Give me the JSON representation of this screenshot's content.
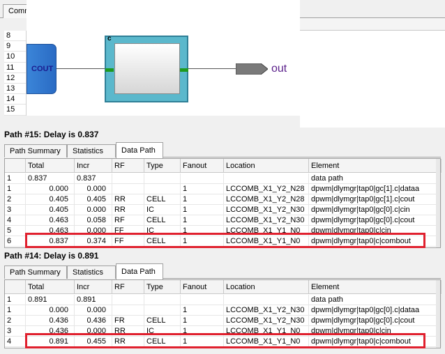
{
  "top": {
    "tab_label": "Comm",
    "row_numbers": [
      "8",
      "9",
      "10",
      "11",
      "12",
      "13",
      "14",
      "15"
    ],
    "schematic": {
      "cout_label": "COUT",
      "cell_label": "c",
      "out_label": "out",
      "colors": {
        "cout_block": "#2a6bc4",
        "cell_block": "#5bb8cc",
        "port": "#1e9a1e",
        "out_text": "#5a1f8a"
      }
    }
  },
  "columns": [
    "",
    "Total",
    "Incr",
    "RF",
    "Type",
    "Fanout",
    "Location",
    "Element"
  ],
  "sub_tabs": [
    "Path Summary",
    "Statistics",
    "Data Path"
  ],
  "active_tab": "Data Path",
  "highlight_color": "#e0202e",
  "paths": [
    {
      "title": "Path #15: Delay is 0.837",
      "rows": [
        [
          "1",
          "0.837",
          "0.837",
          "",
          "",
          "",
          "",
          "data path"
        ],
        [
          "1",
          "0.000",
          "0.000",
          "",
          "",
          "1",
          "LCCOMB_X1_Y2_N28",
          "dpwm|dlymgr|tap0|gc[1].c|dataa"
        ],
        [
          "2",
          "0.405",
          "0.405",
          "RR",
          "CELL",
          "1",
          "LCCOMB_X1_Y2_N28",
          "dpwm|dlymgr|tap0|gc[1].c|cout"
        ],
        [
          "3",
          "0.405",
          "0.000",
          "RR",
          "IC",
          "1",
          "LCCOMB_X1_Y2_N30",
          "dpwm|dlymgr|tap0|gc[0].c|cin"
        ],
        [
          "4",
          "0.463",
          "0.058",
          "RF",
          "CELL",
          "1",
          "LCCOMB_X1_Y2_N30",
          "dpwm|dlymgr|tap0|gc[0].c|cout"
        ],
        [
          "5",
          "0.463",
          "0.000",
          "FF",
          "IC",
          "1",
          "LCCOMB_X1_Y1_N0",
          "dpwm|dlymgr|tap0|c|cin"
        ],
        [
          "6",
          "0.837",
          "0.374",
          "FF",
          "CELL",
          "1",
          "LCCOMB_X1_Y1_N0",
          "dpwm|dlymgr|tap0|c|combout"
        ]
      ]
    },
    {
      "title": "Path #14: Delay is 0.891",
      "rows": [
        [
          "1",
          "0.891",
          "0.891",
          "",
          "",
          "",
          "",
          "data path"
        ],
        [
          "1",
          "0.000",
          "0.000",
          "",
          "",
          "1",
          "LCCOMB_X1_Y2_N30",
          "dpwm|dlymgr|tap0|gc[0].c|dataa"
        ],
        [
          "2",
          "0.436",
          "0.436",
          "FR",
          "CELL",
          "1",
          "LCCOMB_X1_Y2_N30",
          "dpwm|dlymgr|tap0|gc[0].c|cout"
        ],
        [
          "3",
          "0.436",
          "0.000",
          "RR",
          "IC",
          "1",
          "LCCOMB_X1_Y1_N0",
          "dpwm|dlymgr|tap0|c|cin"
        ],
        [
          "4",
          "0.891",
          "0.455",
          "RR",
          "CELL",
          "1",
          "LCCOMB_X1_Y1_N0",
          "dpwm|dlymgr|tap0|c|combout"
        ]
      ]
    }
  ]
}
